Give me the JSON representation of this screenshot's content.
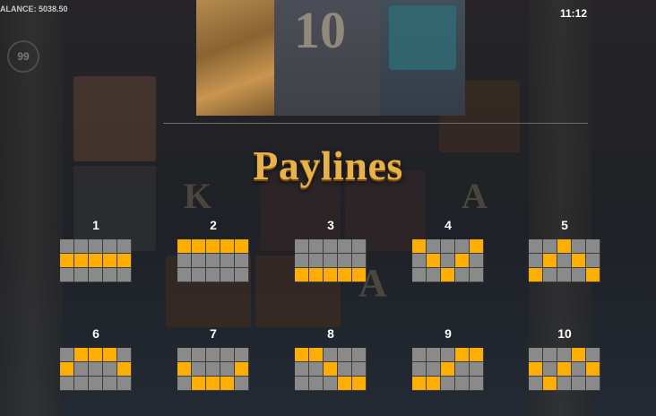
{
  "header": {
    "balance_label": "ALANCE: 5038.50",
    "time": "11:12"
  },
  "title": "Paylines",
  "reel_symbols": [
    "10",
    "A"
  ],
  "background_badge": "99",
  "colors": {
    "active": "#ffae00",
    "inactive": "#8a8a8a",
    "title": "#e8b24a"
  },
  "paylines": [
    {
      "number": "1",
      "pattern": [
        [
          0,
          0,
          0,
          0,
          0
        ],
        [
          1,
          1,
          1,
          1,
          1
        ],
        [
          0,
          0,
          0,
          0,
          0
        ]
      ]
    },
    {
      "number": "2",
      "pattern": [
        [
          1,
          1,
          1,
          1,
          1
        ],
        [
          0,
          0,
          0,
          0,
          0
        ],
        [
          0,
          0,
          0,
          0,
          0
        ]
      ]
    },
    {
      "number": "3",
      "pattern": [
        [
          0,
          0,
          0,
          0,
          0
        ],
        [
          0,
          0,
          0,
          0,
          0
        ],
        [
          1,
          1,
          1,
          1,
          1
        ]
      ]
    },
    {
      "number": "4",
      "pattern": [
        [
          1,
          0,
          0,
          0,
          1
        ],
        [
          0,
          1,
          0,
          1,
          0
        ],
        [
          0,
          0,
          1,
          0,
          0
        ]
      ]
    },
    {
      "number": "5",
      "pattern": [
        [
          0,
          0,
          1,
          0,
          0
        ],
        [
          0,
          1,
          0,
          1,
          0
        ],
        [
          1,
          0,
          0,
          0,
          1
        ]
      ]
    },
    {
      "number": "6",
      "pattern": [
        [
          0,
          1,
          1,
          1,
          0
        ],
        [
          1,
          0,
          0,
          0,
          1
        ],
        [
          0,
          0,
          0,
          0,
          0
        ]
      ]
    },
    {
      "number": "7",
      "pattern": [
        [
          0,
          0,
          0,
          0,
          0
        ],
        [
          1,
          0,
          0,
          0,
          1
        ],
        [
          0,
          1,
          1,
          1,
          0
        ]
      ]
    },
    {
      "number": "8",
      "pattern": [
        [
          1,
          1,
          0,
          0,
          0
        ],
        [
          0,
          0,
          1,
          0,
          0
        ],
        [
          0,
          0,
          0,
          1,
          1
        ]
      ]
    },
    {
      "number": "9",
      "pattern": [
        [
          0,
          0,
          0,
          1,
          1
        ],
        [
          0,
          0,
          1,
          0,
          0
        ],
        [
          1,
          1,
          0,
          0,
          0
        ]
      ]
    },
    {
      "number": "10",
      "pattern": [
        [
          0,
          0,
          0,
          1,
          0
        ],
        [
          1,
          0,
          1,
          0,
          1
        ],
        [
          0,
          1,
          0,
          0,
          0
        ]
      ]
    }
  ]
}
